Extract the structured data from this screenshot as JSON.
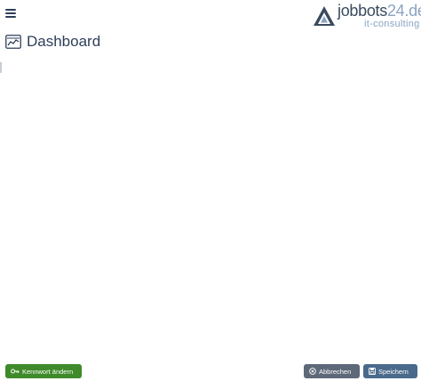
{
  "header": {
    "logo": {
      "name_main": "jobbots",
      "name_accent": "24.de",
      "tagline": "it-consulting"
    }
  },
  "page": {
    "title": "Dashboard"
  },
  "footer": {
    "change_password_label": "Kennwort ändern",
    "cancel_label": "Abbrechen",
    "save_label": "Speichern"
  },
  "icons": {
    "menu": "hamburger-menu-icon",
    "dashboard": "chart-icon",
    "key": "key-icon",
    "cancel": "close-circle-icon",
    "save": "floppy-disk-icon"
  },
  "colors": {
    "title_text": "#2f3e5a",
    "logo_accent": "#8aa3c2",
    "change_password_button": "#3f8a2a",
    "cancel_button": "#5d6878",
    "save_button": "#4a6a8c"
  }
}
